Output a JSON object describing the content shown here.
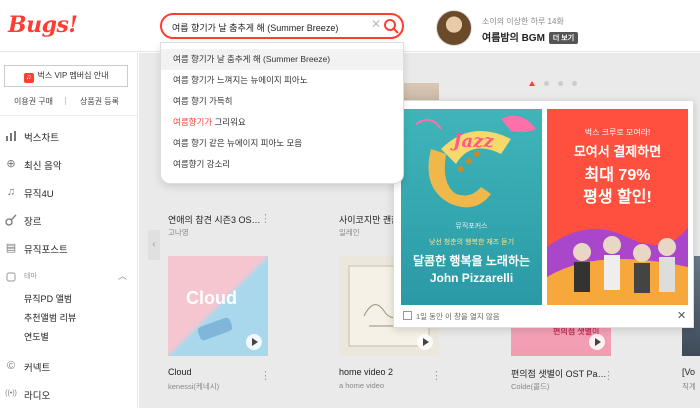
{
  "header": {
    "logo": "Bugs!",
    "search": {
      "value": "여름 향기가 날 춤추게 해 (Summer Breeze)"
    },
    "profile": {
      "subtitle": "소이의 이상한 하루 14화",
      "title": "여름밤의 BGM",
      "more_badge": "더 보기"
    }
  },
  "suggestions": [
    {
      "pre": "여름 향기가 날 춤추게 해 (Summer Breeze)",
      "hl": "",
      "post": ""
    },
    {
      "pre": "여름 향기가 느껴지는 뉴에이지 피아노",
      "hl": "",
      "post": ""
    },
    {
      "pre": "여름 향기 가득히",
      "hl": "",
      "post": ""
    },
    {
      "pre": "",
      "hl": "여름향기가",
      "post": " 그리워요"
    },
    {
      "pre": "여름 향기 같은 뉴에이지 피아노 모음",
      "hl": "",
      "post": ""
    },
    {
      "pre": "여름향기 강소리",
      "hl": "",
      "post": ""
    }
  ],
  "sidebar": {
    "vip_button": "벅스 VIP 멤버십 안내",
    "vip_icon_glyph": "♫",
    "link_a": "이용권 구매",
    "link_b": "상품권 등록",
    "nav": [
      {
        "label": "벅스차트",
        "icon": "bar-chart-icon",
        "glyph": "📊"
      },
      {
        "label": "최신 음악",
        "icon": "plus-circle-icon",
        "glyph": "⊕"
      },
      {
        "label": "뮤직4U",
        "icon": "music-note-icon",
        "glyph": "♫"
      },
      {
        "label": "장르",
        "icon": "guitar-icon",
        "glyph": "🎸"
      },
      {
        "label": "뮤직포스트",
        "icon": "document-icon",
        "glyph": "▤"
      }
    ],
    "theme_label": "테마",
    "theme_sub": [
      "뮤직PD 앨범",
      "추천앨범 리뷰",
      "연도별"
    ],
    "bottom_nav": [
      {
        "label": "커넥트",
        "icon": "connect-icon",
        "glyph": "©"
      },
      {
        "label": "라디오",
        "icon": "radio-icon",
        "glyph": "((•))"
      }
    ]
  },
  "cards_row1": [
    {
      "title": "연애의 참견 시즌3 OS…",
      "sub": "고나영"
    },
    {
      "title": "사이코지만 괜찮",
      "sub": "일레인"
    }
  ],
  "cards_row2": [
    {
      "title": "Cloud",
      "sub": "kenessi(케네시)",
      "art_text": "Cloud"
    },
    {
      "title": "home video 2",
      "sub": "a home video"
    },
    {
      "title": "편의점 샛별이 OST Pa…",
      "sub": "Colde(콜드)",
      "art_text": "편의점 샛별이"
    },
    {
      "title": "[Vo",
      "sub": "직계"
    }
  ],
  "promo": {
    "jazz": {
      "word": "Jazz",
      "small": "뮤직포커스",
      "line1": "낮선 청춘의 행복한 재즈 듣기",
      "line2": "달콤한 행복을 노래하는",
      "line3": "John Pizzarelli"
    },
    "vip": {
      "line0": "벅스 크루로 모여라!",
      "line1": "모여서 결제하면",
      "line2": "최대 79%",
      "line3": "평생 할인!"
    },
    "footer": "1일 동안 이 창을 열지 않음",
    "close": "✕"
  },
  "colors": {
    "accent": "#ff3d33",
    "jazz_bg": "#3fb5b9",
    "vip_bg": "#ff4f3e"
  }
}
